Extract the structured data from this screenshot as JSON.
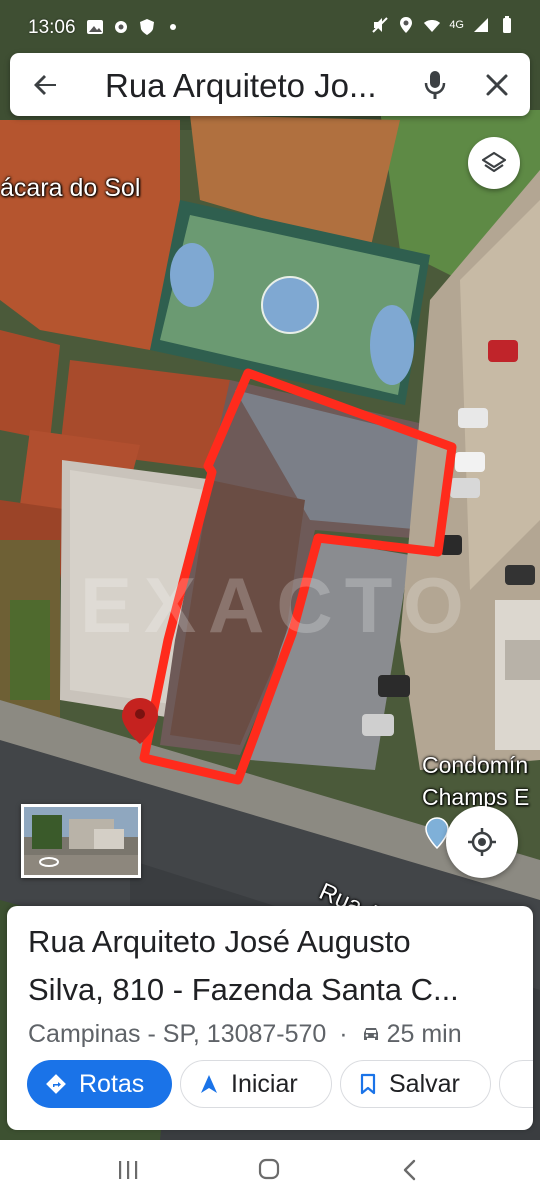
{
  "status_bar": {
    "time": "13:06",
    "left_icons": [
      "gallery-icon",
      "settings-icon",
      "shield-icon",
      "dot-icon"
    ],
    "right_icons": [
      "mute-icon",
      "location-icon",
      "wifi-icon",
      "network-4g-icon",
      "signal-icon",
      "battery-icon"
    ],
    "network_label": "4G"
  },
  "search": {
    "query": "Rua Arquiteto Jo...",
    "back_icon": "arrow-left-icon",
    "mic_icon": "mic-icon",
    "close_icon": "close-icon"
  },
  "map": {
    "labels": {
      "chacara": "ácara do Sol",
      "condo_line1": "Condomín",
      "condo_line2": "Champs E",
      "street": "Rua A"
    },
    "watermark": "EXACTO",
    "highlight_color": "#ff2b1c",
    "pin_color": "#c5221f"
  },
  "card": {
    "title_line1": "Rua Arquiteto José Augusto",
    "title_line2": "Silva, 810 - Fazenda Santa C...",
    "locality": "Campinas - SP, 13087-570",
    "separator": "·",
    "drive_time": "25 min",
    "buttons": {
      "routes": "Rotas",
      "start": "Iniciar",
      "save": "Salvar"
    },
    "accent_color": "#1a73e8"
  },
  "nav_bar": {
    "icons": [
      "recent-apps-icon",
      "home-icon",
      "back-icon"
    ]
  }
}
